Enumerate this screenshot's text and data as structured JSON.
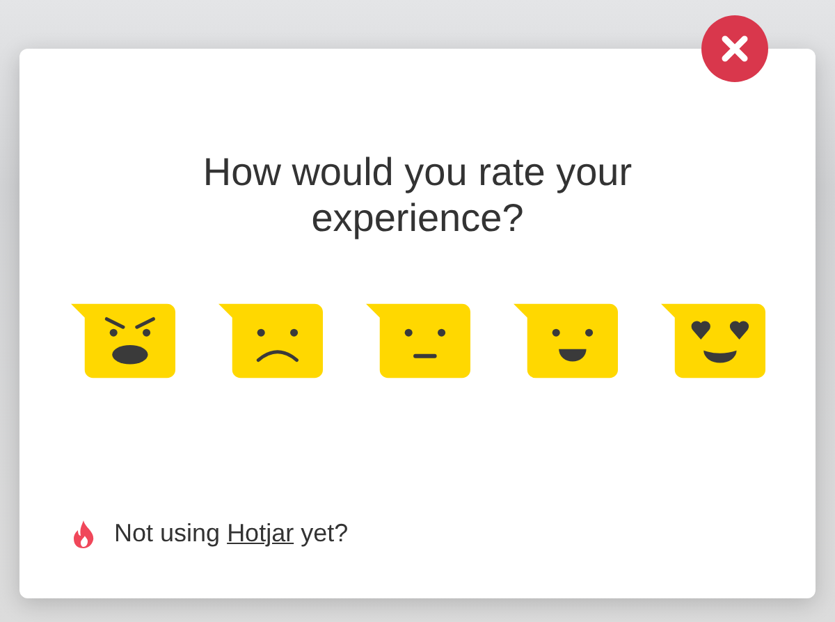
{
  "dialog": {
    "title": "How would you rate your experience?"
  },
  "ratings": [
    {
      "kind": "angry"
    },
    {
      "kind": "sad"
    },
    {
      "kind": "neutral"
    },
    {
      "kind": "happy"
    },
    {
      "kind": "love"
    }
  ],
  "footer": {
    "before": "Not using",
    "link": "Hotjar",
    "after": "yet?"
  }
}
